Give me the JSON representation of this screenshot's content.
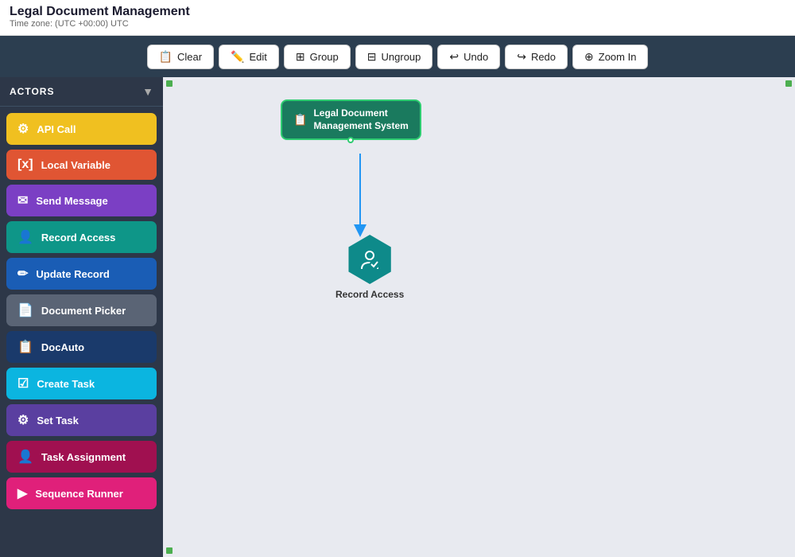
{
  "app": {
    "title": "Legal Document Management",
    "subtitle": "Time zone: (UTC +00:00) UTC"
  },
  "toolbar": {
    "buttons": [
      {
        "id": "clear",
        "label": "Clear",
        "icon": "📋"
      },
      {
        "id": "edit",
        "label": "Edit",
        "icon": "✏️"
      },
      {
        "id": "group",
        "label": "Group",
        "icon": "⊞"
      },
      {
        "id": "ungroup",
        "label": "Ungroup",
        "icon": "⊟"
      },
      {
        "id": "undo",
        "label": "Undo",
        "icon": "↩"
      },
      {
        "id": "redo",
        "label": "Redo",
        "icon": "↪"
      },
      {
        "id": "zoom-in",
        "label": "Zoom In",
        "icon": "⊕"
      }
    ]
  },
  "sidebar": {
    "header": "ACTORS",
    "items": [
      {
        "id": "api-call",
        "label": "API Call",
        "color": "#f0c020",
        "icon": "⚙"
      },
      {
        "id": "local-variable",
        "label": "Local Variable",
        "color": "#e05533",
        "icon": "[x]"
      },
      {
        "id": "send-message",
        "label": "Send Message",
        "color": "#7b3fc4",
        "icon": "✉"
      },
      {
        "id": "record-access",
        "label": "Record Access",
        "color": "#0e9688",
        "icon": "👤"
      },
      {
        "id": "update-record",
        "label": "Update Record",
        "color": "#1a5db5",
        "icon": "✏"
      },
      {
        "id": "document-picker",
        "label": "Document Picker",
        "color": "#5a6475",
        "icon": "📄"
      },
      {
        "id": "docauto",
        "label": "DocAuto",
        "color": "#1a3a6b",
        "icon": "📋"
      },
      {
        "id": "create-task",
        "label": "Create Task",
        "color": "#0bb5e0",
        "icon": "☑"
      },
      {
        "id": "set-task",
        "label": "Set Task",
        "color": "#5a3fa0",
        "icon": "⚙"
      },
      {
        "id": "task-assignment",
        "label": "Task Assignment",
        "color": "#a01050",
        "icon": "👤"
      },
      {
        "id": "sequence-runner",
        "label": "Sequence Runner",
        "color": "#e0207a",
        "icon": "▶"
      }
    ]
  },
  "canvas": {
    "start_node": {
      "label": "Legal Document\nManagement System",
      "icon": "📋"
    },
    "record_access_node": {
      "label": "Record Access"
    }
  }
}
